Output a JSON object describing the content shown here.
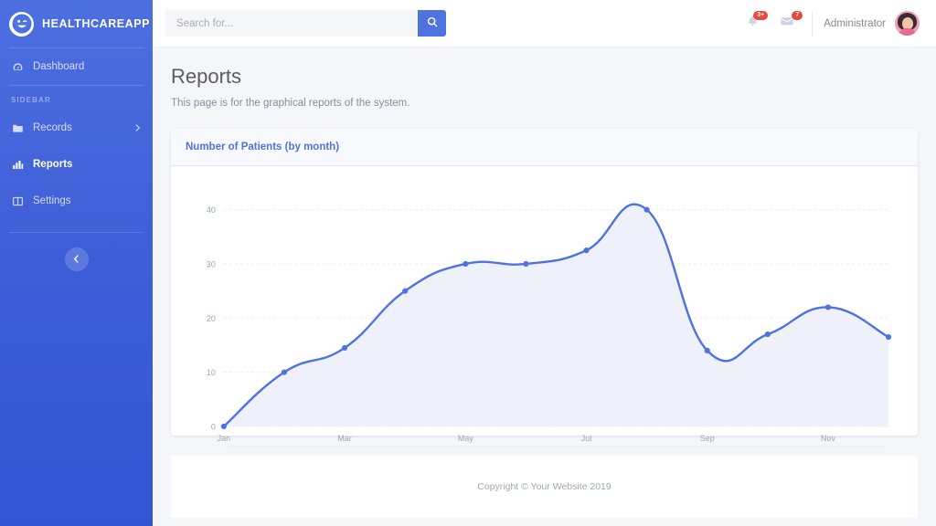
{
  "brand": {
    "name": "HEALTHCAREAPP",
    "logo_icon": "smiley-wink-icon"
  },
  "sidebar": {
    "section_heading": "SIDEBAR",
    "items": [
      {
        "label": "Dashboard",
        "icon": "tachometer-icon",
        "active": false,
        "has_chevron": false
      },
      {
        "label": "Records",
        "icon": "folder-icon",
        "active": false,
        "has_chevron": true
      },
      {
        "label": "Reports",
        "icon": "chart-bar-icon",
        "active": true,
        "has_chevron": false
      },
      {
        "label": "Settings",
        "icon": "table-icon",
        "active": false,
        "has_chevron": false
      }
    ],
    "collapse_icon": "chevron-left-icon"
  },
  "topbar": {
    "search": {
      "placeholder": "Search for...",
      "value": "",
      "button_icon": "search-icon"
    },
    "alerts": {
      "icon": "bell-icon",
      "badge": "3+"
    },
    "messages": {
      "icon": "envelope-icon",
      "badge": "7"
    },
    "user": {
      "name": "Administrator",
      "avatar_icon": "user-avatar"
    }
  },
  "page": {
    "title": "Reports",
    "subtitle": "This page is for the graphical reports of the system."
  },
  "card": {
    "title": "Number of Patients (by month)"
  },
  "footer": {
    "text": "Copyright © Your Website 2019"
  },
  "colors": {
    "brand_blue": "#4e73df",
    "sidebar_top": "#4c6fe0",
    "sidebar_bottom": "#3355d4",
    "badge_red": "#e74a3b",
    "title_gray": "#5a5c69",
    "axis_gray": "#a0a5b3",
    "area_fill": "#eef1f9"
  },
  "chart_data": {
    "type": "area",
    "title": "Number of Patients (by month)",
    "xlabel": "",
    "ylabel": "",
    "categories": [
      "Jan",
      "Feb",
      "Mar",
      "Apr",
      "May",
      "Jun",
      "Jul",
      "Aug",
      "Sep",
      "Oct",
      "Nov",
      "Dec"
    ],
    "tick_labels_x": [
      "Jan",
      "",
      "Mar",
      "",
      "May",
      "",
      "Jul",
      "",
      "Sep",
      "",
      "Nov",
      ""
    ],
    "values": [
      0,
      10,
      14.5,
      25,
      30,
      30,
      32.5,
      40,
      14,
      17,
      22,
      16.5
    ],
    "ylim": [
      0,
      45
    ],
    "yticks": [
      0,
      10,
      20,
      30,
      40
    ],
    "grid": true,
    "grid_style": "dashed-horizontal",
    "legend": false,
    "line_color": "#4e73df",
    "fill_color": "#eef1f9",
    "point_marker": "circle"
  }
}
